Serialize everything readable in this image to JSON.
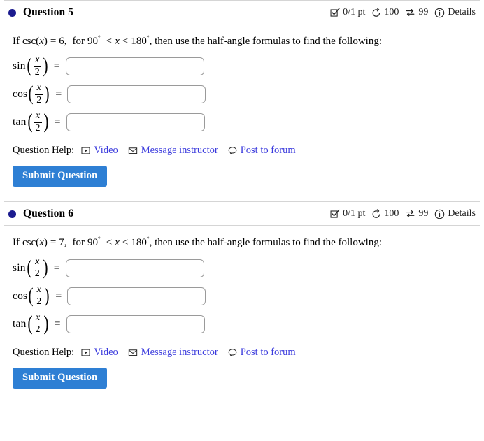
{
  "meta_icons": {
    "score_icon": "checkbox-check-icon",
    "attempts_icon": "undo-circular-arrow-icon",
    "swap_icon": "exchange-arrows-icon",
    "details_icon": "info-circle-icon"
  },
  "help": {
    "label": "Question Help:",
    "links": [
      {
        "icon": "video-play-icon",
        "label": "Video"
      },
      {
        "icon": "envelope-icon",
        "label": "Message instructor"
      },
      {
        "icon": "comment-bubble-icon",
        "label": "Post to forum"
      }
    ],
    "link_color": "#3b3bdd"
  },
  "submit": {
    "label": "Submit Question",
    "color": "#2e7fd4"
  },
  "colors": {
    "bullet": "#1b1b8f",
    "divider": "#d5d5d5",
    "input_border": "#9a9a9a"
  },
  "questions": [
    {
      "title": "Question 5",
      "score": "0/1 pt",
      "attempts": "100",
      "versions": "99",
      "details": "Details",
      "prompt": {
        "lead": "If",
        "fn": "csc",
        "var": "x",
        "equals": "=",
        "value": "6",
        "for": "for",
        "lower": "90",
        "deg": "°",
        "rel1": "<",
        "relvar": "x",
        "rel2": "<",
        "upper": "180",
        "tail": ", then use the half-angle formulas to find the following:"
      },
      "answers": [
        {
          "fn": "sin",
          "num": "x",
          "den": "2",
          "value": ""
        },
        {
          "fn": "cos",
          "num": "x",
          "den": "2",
          "value": ""
        },
        {
          "fn": "tan",
          "num": "x",
          "den": "2",
          "value": ""
        }
      ]
    },
    {
      "title": "Question 6",
      "score": "0/1 pt",
      "attempts": "100",
      "versions": "99",
      "details": "Details",
      "prompt": {
        "lead": "If",
        "fn": "csc",
        "var": "x",
        "equals": "=",
        "value": "7",
        "for": "for",
        "lower": "90",
        "deg": "°",
        "rel1": "<",
        "relvar": "x",
        "rel2": "<",
        "upper": "180",
        "tail": ", then use the half-angle formulas to find the following:"
      },
      "answers": [
        {
          "fn": "sin",
          "num": "x",
          "den": "2",
          "value": ""
        },
        {
          "fn": "cos",
          "num": "x",
          "den": "2",
          "value": ""
        },
        {
          "fn": "tan",
          "num": "x",
          "den": "2",
          "value": ""
        }
      ]
    }
  ]
}
